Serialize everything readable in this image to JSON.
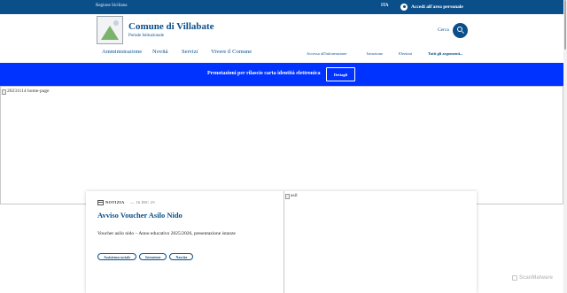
{
  "topbar": {
    "region": "Regione Siciliana",
    "language": "ITA",
    "login_label": "Accedi all'area personale"
  },
  "header": {
    "title": "Comune di Villabate",
    "subtitle": "Portale Istituzionale",
    "search_label": "Cerca",
    "main_nav": [
      "Amministrazione",
      "Novità",
      "Servizi",
      "Vivere il Comune"
    ],
    "secondary_nav": [
      "Accesso all'informazione",
      "Istruzione",
      "Elezioni",
      "Tutti gli argomenti..."
    ]
  },
  "banner": {
    "text": "Prenotazioni per rilascio carta identità elettronica",
    "button_label": "Dettagli"
  },
  "hero": {
    "image_alt": "20231114 home-page"
  },
  "news": {
    "tag": "NOTIZIA",
    "date": "— 16 DIC 25",
    "title": "Avviso Voucher Asilo Nido",
    "description": "Voucher asilo nido – Anno educativo 2025/2026, presentazione istanze",
    "chips": [
      "Assistenza sociale",
      "Istruzione",
      "Nascita"
    ],
    "image_alt": "asil"
  },
  "watermark": {
    "text": "ScanMalware"
  },
  "colors": {
    "brand": "#0a4f8a",
    "banner": "#0033ff"
  }
}
